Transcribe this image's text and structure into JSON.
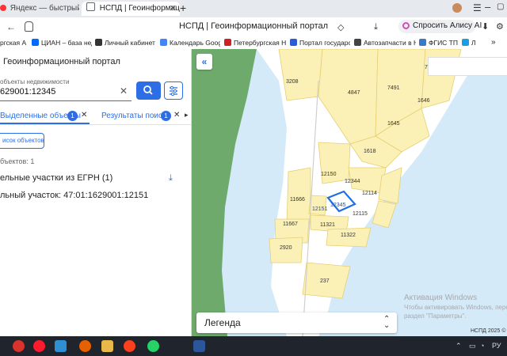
{
  "browser": {
    "tabs": [
      {
        "title": "Яндекс — быстрый поиск",
        "active": false
      },
      {
        "title": "НСПД | Геоинформацио",
        "active": true
      }
    ],
    "new_tab": "+",
    "page_title": "НСПД | Геоинформационный портал",
    "alice_label": "Спросить Алису AI"
  },
  "bookmarks": [
    {
      "label": "ргская А",
      "color": "#2a7de1"
    },
    {
      "label": "ЦИАН – база нед",
      "color": "#0468ff"
    },
    {
      "label": "Личный кабинет",
      "color": "#333333"
    },
    {
      "label": "Календарь Google",
      "color": "#4285f4"
    },
    {
      "label": "Петербургская Н",
      "color": "#cc2222"
    },
    {
      "label": "Портал государс",
      "color": "#2d5bd5"
    },
    {
      "label": "Автозапчасти в Н",
      "color": "#444444"
    },
    {
      "label": "ФГИС ТП",
      "color": "#3a78c8"
    },
    {
      "label": "Л",
      "color": "#1a9ee3"
    }
  ],
  "panel": {
    "title": "Геоинформационный портал",
    "search_label": "объекты недвижимости",
    "search_value": "629001:12345",
    "tabs": [
      {
        "label": "Выделенные объекты",
        "count": "1"
      },
      {
        "label": "Результаты поиска",
        "count": "1"
      }
    ],
    "list_button": "исок объектов",
    "objects_count": "бъектов: 1",
    "group_title": "ельные участки из ЕГРН (1)",
    "item_label": "льный участок: 47:01:1629001:12151"
  },
  "map": {
    "legend": "Легенда",
    "footer": "НСПД 2025 ©",
    "watermark_line1": "Активация Windows",
    "watermark_line2": "Чтобы активировать Windows, перейдите в",
    "watermark_line3": "раздел \"Параметры\"."
  },
  "parcels": [
    "3208",
    "4847",
    "7491",
    "1646",
    "1645",
    "1618",
    "12150",
    "12344",
    "12114",
    "11666",
    "12345",
    "12151",
    "12115",
    "11667",
    "11321",
    "11322",
    "2920",
    "237",
    "74"
  ],
  "colors": {
    "parcel_fill": "#fbf1b6",
    "parcel_stroke": "#e6cf73",
    "water": "#d4eaf9",
    "forest": "#6faa6d",
    "accent": "#2d6ee7",
    "selected": "#1f6fe6"
  }
}
